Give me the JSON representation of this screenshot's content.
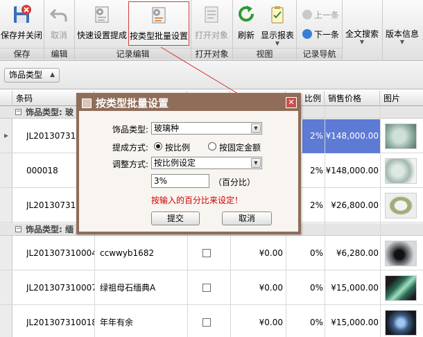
{
  "toolbar": {
    "save_close": "保存并关闭",
    "cancel": "取消",
    "quick_setting": "快速设置提成",
    "batch_setting": "按类型批量设置",
    "open_object": "打开对象",
    "refresh": "刷新",
    "show_report": "显示报表",
    "prev": "上一条",
    "next": "下一条",
    "fulltext": "全文搜索",
    "version": "版本信息",
    "groups": {
      "save": "保存",
      "edit": "编辑",
      "record_edit": "记录编辑",
      "open_object": "打开对象",
      "view": "视图",
      "record_nav": "记录导航"
    }
  },
  "filter": {
    "group_field": "饰品类型"
  },
  "grid": {
    "columns": [
      "条码",
      "",
      "",
      "",
      "比例",
      "销售价格",
      "图片"
    ],
    "groups": [
      {
        "label": "饰品类型: 玻"
      },
      {
        "label": "饰品类型: 缅"
      }
    ],
    "rows": [
      {
        "barcode": "JL201307310",
        "name": "",
        "ratio": "2%",
        "price": "¥148,000.00",
        "thumb_color": "#8fb0a0"
      },
      {
        "barcode": "000018",
        "name": "",
        "ratio": "2%",
        "price": "¥148,000.00",
        "thumb_color": "#a3b9ae"
      },
      {
        "barcode": "JL201307310",
        "name": "",
        "ratio": "2%",
        "price": "¥26,800.00",
        "thumb_color": "#9fae79"
      },
      {
        "barcode": "JL201307310004",
        "name": "ccwwyb1682",
        "amount": "¥0.00",
        "ratio": "0%",
        "price": "¥6,280.00",
        "thumb_color": "#3a3f46"
      },
      {
        "barcode": "JL201307310007",
        "name": "绿祖母石缅典A",
        "amount": "¥0.00",
        "ratio": "0%",
        "price": "¥15,000.00",
        "thumb_color": "#2c6b57"
      },
      {
        "barcode": "JL201307310018",
        "name": "年年有余",
        "amount": "¥0.00",
        "ratio": "0%",
        "price": "¥15,000.00",
        "thumb_color": "#3c5c82"
      }
    ]
  },
  "dialog": {
    "title": "按类型批量设置",
    "type_label": "饰品类型:",
    "type_value": "玻璃种",
    "mode_label": "提成方式:",
    "mode_ratio": "按比例",
    "mode_fixed": "按固定金额",
    "adjust_label": "调整方式:",
    "adjust_value": "按比例设定",
    "percent_value": "3%",
    "percent_unit": "（百分比）",
    "hint": "按输入的百分比来设定！",
    "submit": "提交",
    "cancel": "取消"
  }
}
